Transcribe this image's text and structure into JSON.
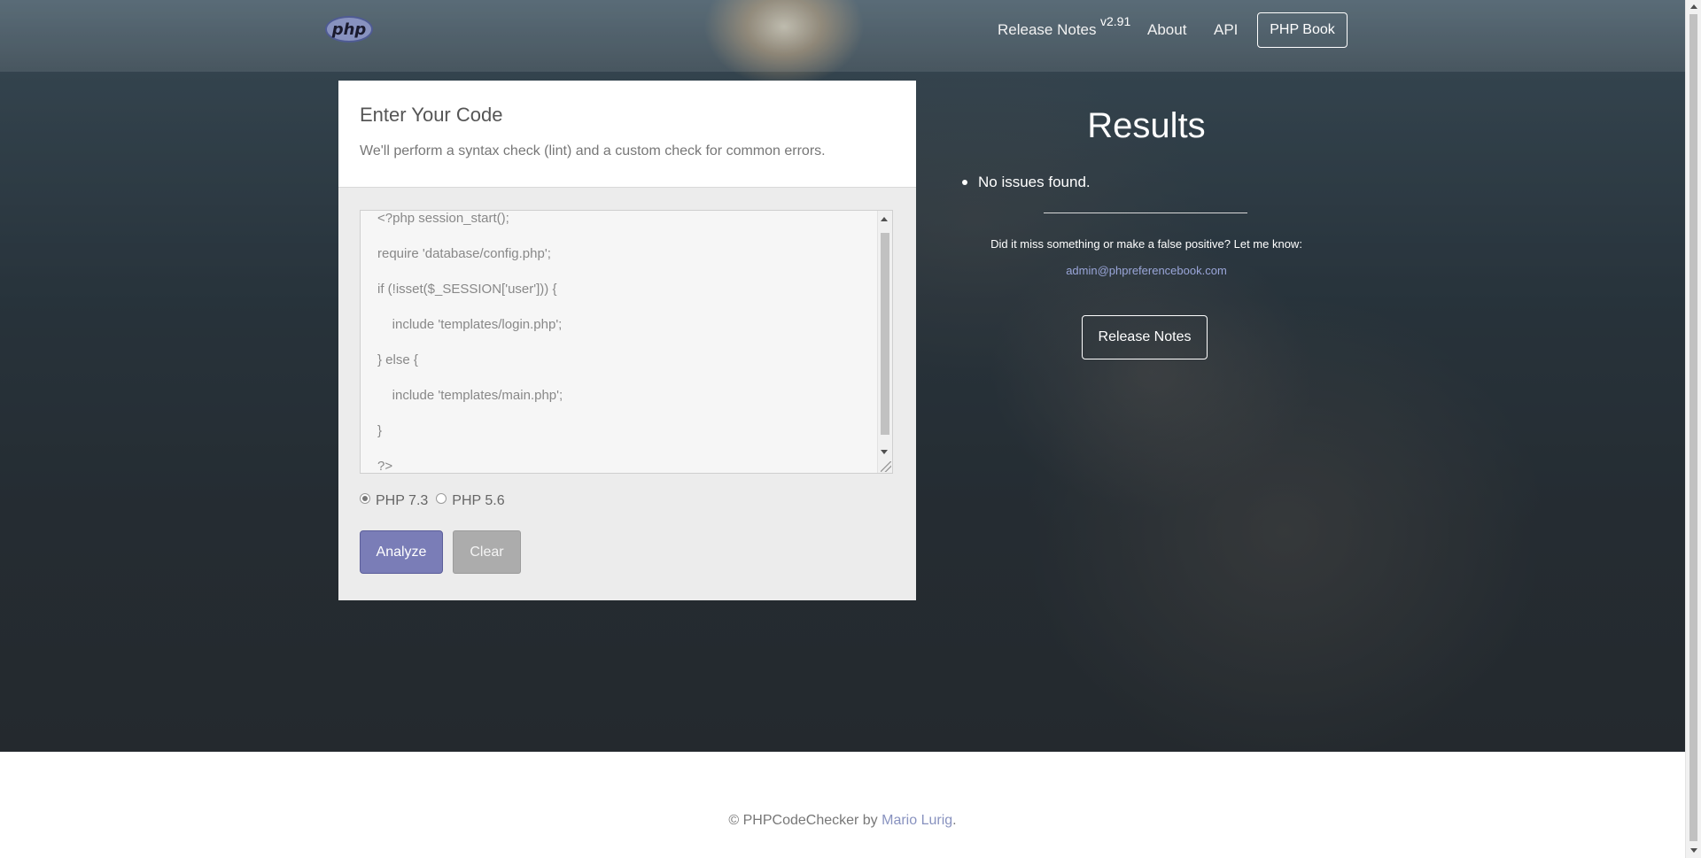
{
  "nav": {
    "logo_text": "php",
    "release_notes": "Release Notes",
    "version": "v2.91",
    "about": "About",
    "api": "API",
    "php_book": "PHP Book"
  },
  "editor": {
    "title": "Enter Your Code",
    "subtitle": "We'll perform a syntax check (lint) and a custom check for common errors.",
    "code_lines": [
      "<?php session_start();",
      "require 'database/config.php';",
      "if (!isset($_SESSION['user'])) {",
      "    include 'templates/login.php';",
      "} else {",
      "    include 'templates/main.php';",
      "}",
      "?>"
    ],
    "php_versions": [
      {
        "label": "PHP 7.3",
        "selected": true
      },
      {
        "label": "PHP 5.6",
        "selected": false
      }
    ],
    "analyze_label": "Analyze",
    "clear_label": "Clear"
  },
  "results": {
    "title": "Results",
    "items": [
      "No issues found."
    ],
    "feedback_text": "Did it miss something or make a false positive? Let me know:",
    "email": "admin@phpreferencebook.com",
    "release_notes_button": "Release Notes"
  },
  "footer": {
    "prefix": "© PHPCodeChecker by ",
    "author": "Mario Lurig",
    "suffix": "."
  },
  "colors": {
    "accent": "#7a7db7",
    "link": "#8892bf"
  }
}
